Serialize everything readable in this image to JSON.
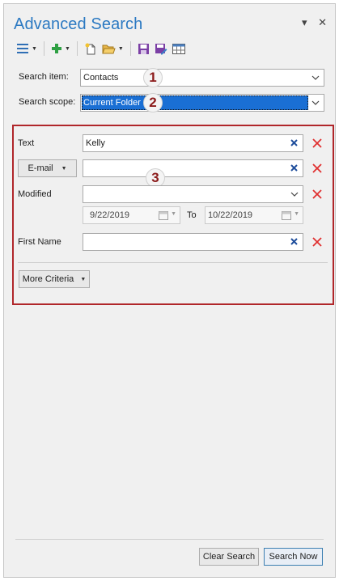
{
  "pane": {
    "title": "Advanced Search",
    "controls": {
      "dropdown_glyph": "▾",
      "close_glyph": "✕"
    }
  },
  "form": {
    "search_item": {
      "label": "Search item:",
      "value": "Contacts"
    },
    "search_scope": {
      "label": "Search scope:",
      "value": "Current Folder"
    }
  },
  "criteria": {
    "text": {
      "label": "Text",
      "value": "Kelly"
    },
    "email": {
      "label": "E-mail",
      "value": ""
    },
    "modified": {
      "label": "Modified",
      "value": "",
      "from_date": "9/22/2019",
      "to_label": "To",
      "to_date": "10/22/2019"
    },
    "first_name": {
      "label": "First Name",
      "value": ""
    },
    "more_criteria_label": "More Criteria"
  },
  "annotations": {
    "badge1": "1",
    "badge2": "2",
    "badge3": "3"
  },
  "footer": {
    "clear_label": "Clear Search",
    "search_label": "Search Now"
  },
  "colors": {
    "title": "#2b79c2",
    "highlight_border": "#b0262a",
    "delete_x": "#e03030",
    "clear_x": "#1f4e9c",
    "selection": "#1a6fd4"
  }
}
